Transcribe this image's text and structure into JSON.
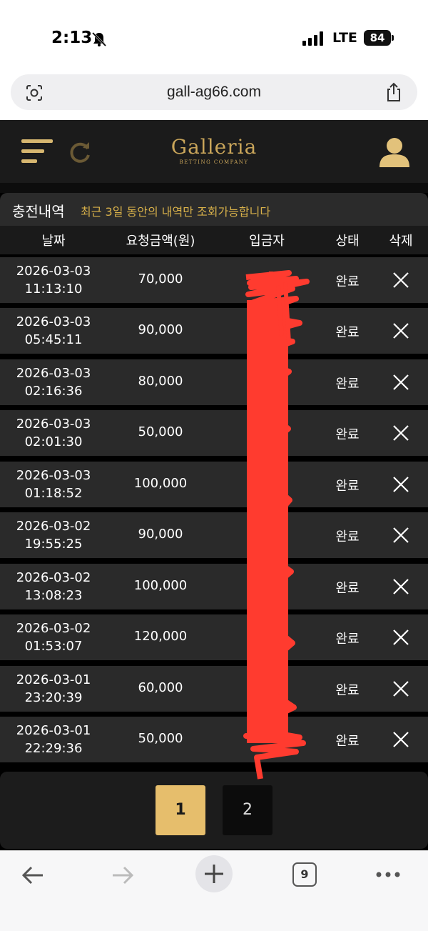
{
  "status_bar": {
    "time": "2:13",
    "network": "LTE",
    "battery": "84"
  },
  "browser": {
    "url": "gall-ag66.com",
    "tab_count": "9"
  },
  "site": {
    "brand": "Galleria",
    "tagline": "BETTING COMPANY"
  },
  "section": {
    "title": "충전내역",
    "notice": "최근 3일 동안의 내역만 조회가능합니다"
  },
  "columns": {
    "date": "날짜",
    "amount": "요청금액(원)",
    "depositor": "입금자",
    "status": "상태",
    "delete": "삭제"
  },
  "rows": [
    {
      "date": "2026-03-03",
      "time": "11:13:10",
      "amount": "70,000",
      "status": "완료"
    },
    {
      "date": "2026-03-03",
      "time": "05:45:11",
      "amount": "90,000",
      "status": "완료"
    },
    {
      "date": "2026-03-03",
      "time": "02:16:36",
      "amount": "80,000",
      "status": "완료"
    },
    {
      "date": "2026-03-03",
      "time": "02:01:30",
      "amount": "50,000",
      "status": "완료"
    },
    {
      "date": "2026-03-03",
      "time": "01:18:52",
      "amount": "100,000",
      "status": "완료"
    },
    {
      "date": "2026-03-02",
      "time": "19:55:25",
      "amount": "90,000",
      "status": "완료"
    },
    {
      "date": "2026-03-02",
      "time": "13:08:23",
      "amount": "100,000",
      "status": "완료"
    },
    {
      "date": "2026-03-02",
      "time": "01:53:07",
      "amount": "120,000",
      "status": "완료"
    },
    {
      "date": "2026-03-01",
      "time": "23:20:39",
      "amount": "60,000",
      "status": "완료"
    },
    {
      "date": "2026-03-01",
      "time": "22:29:36",
      "amount": "50,000",
      "status": "완료"
    }
  ],
  "pagination": {
    "pages": [
      "1",
      "2"
    ],
    "current": "1"
  },
  "colors": {
    "gold": "#c9a55a",
    "notice": "#d8b14a",
    "active_page": "#e6be6c",
    "row_bg": "#2a2a2a",
    "redaction": "#ff3b2f"
  }
}
